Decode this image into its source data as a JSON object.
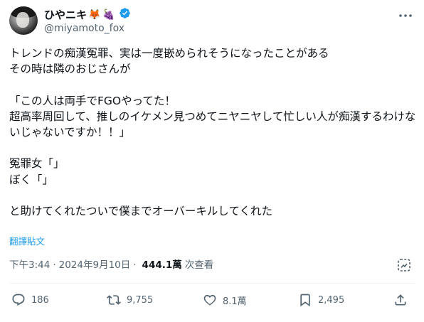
{
  "author": {
    "display_name": "ひやニキ",
    "emojis": [
      "🦊",
      "🍇"
    ],
    "handle": "@miyamoto_fox"
  },
  "tweet": {
    "text": "トレンドの痴漢冤罪、実は一度嵌められそうになったことがある\nその時は隣のおじさんが\n\n「この人は両手でFGOやってた！\n超高率周回して、推しのイケメン見つめてニヤニヤして忙しい人が痴漢するわけないじゃないですか！！」\n\n冤罪女「」\nぼく「」\n\nと助けてくれたついで僕までオーバーキルしてくれた",
    "translate_label": "翻譯貼文"
  },
  "meta": {
    "time": "下午3:44",
    "separator": "·",
    "date": "2024年9月10日",
    "views_count": "444.1萬",
    "views_label": "次查看"
  },
  "actions": {
    "replies": "186",
    "reposts": "9,755",
    "likes": "8.1萬",
    "bookmarks": "2,495"
  },
  "colors": {
    "verified": "#1d9bf0",
    "link": "#1d9bf0",
    "secondary_text": "#536471"
  },
  "icons": [
    "verified-badge-icon",
    "more-icon",
    "grok-icon",
    "reply-icon",
    "repost-icon",
    "like-icon",
    "bookmark-icon",
    "share-icon"
  ]
}
